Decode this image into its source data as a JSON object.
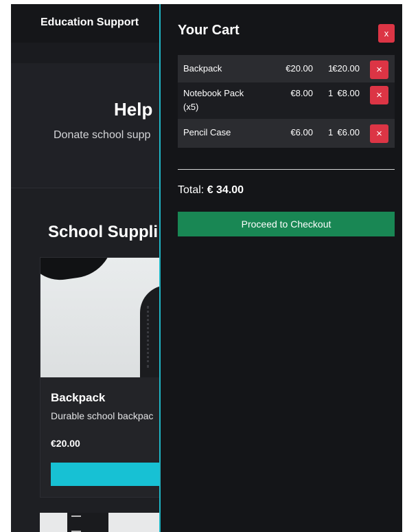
{
  "navbar": {
    "brand": "Education Support"
  },
  "hero": {
    "title": "Help",
    "subtitle": "Donate school supp"
  },
  "section": {
    "title": "School Suppli"
  },
  "products": [
    {
      "name": "Backpack",
      "description": "Durable school backpac",
      "price": "€20.00"
    }
  ],
  "cart": {
    "title": "Your Cart",
    "close_label": "x",
    "items": [
      {
        "name": "Backpack",
        "price": "€20.00",
        "qty": "1",
        "subtotal": "€20.00",
        "remove_label": "×"
      },
      {
        "name": "Notebook Pack (x5)",
        "price": "€8.00",
        "qty": "1",
        "subtotal": "€8.00",
        "remove_label": "×"
      },
      {
        "name": "Pencil Case",
        "price": "€6.00",
        "qty": "1",
        "subtotal": "€6.00",
        "remove_label": "×"
      }
    ],
    "total_label": "Total:",
    "total_value": "€ 34.00",
    "checkout_label": "Proceed to Checkout"
  },
  "colors": {
    "accent": "#17c1d4",
    "danger": "#dc3545",
    "success": "#198754",
    "background": "#1e1f23",
    "panel": "#141518"
  }
}
